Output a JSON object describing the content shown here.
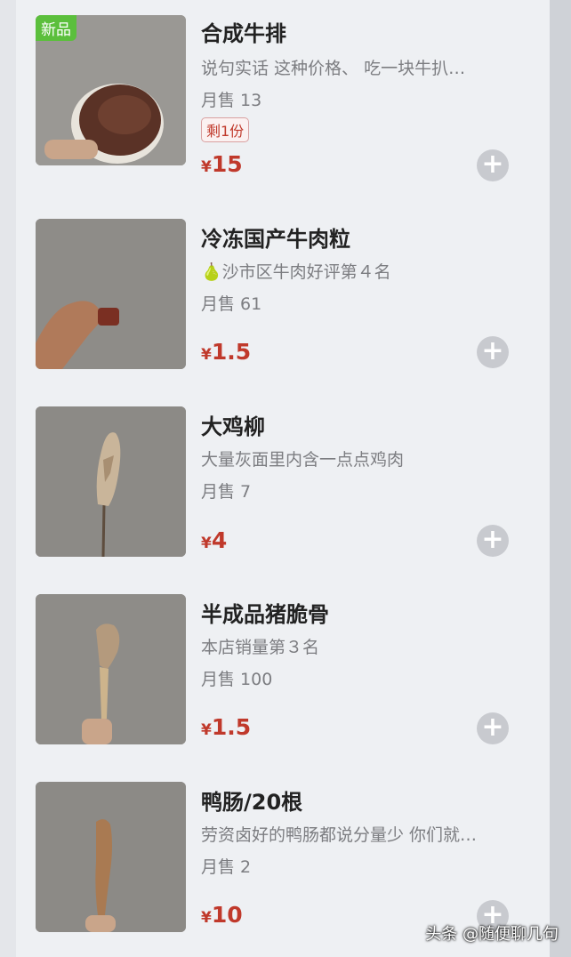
{
  "items": [
    {
      "title": "合成牛排",
      "desc": "说句实话 这种价格、 吃一块牛扒…",
      "sales": "月售 13",
      "stock": "剩1份",
      "badge": "新品",
      "currency": "¥",
      "price": "15"
    },
    {
      "title": "冷冻国产牛肉粒",
      "desc": "🍐沙市区牛肉好评第４名",
      "sales": "月售 61",
      "currency": "¥",
      "price": "1.5"
    },
    {
      "title": "大鸡柳",
      "desc": "大量灰面里内含一点点鸡肉",
      "sales": "月售 7",
      "currency": "¥",
      "price": "4"
    },
    {
      "title": "半成品猪脆骨",
      "desc": "本店销量第３名",
      "sales": "月售 100",
      "currency": "¥",
      "price": "1.5"
    },
    {
      "title": "鸭肠/20根",
      "desc": "劳资卤好的鸭肠都说分量少 你们就…",
      "sales": "月售 2",
      "currency": "¥",
      "price": "10"
    }
  ],
  "add_icon": "plus-circle-icon",
  "watermark": "头条 @随便聊几句",
  "colors": {
    "price": "#c0392b",
    "badge_new": "#5bbf3c",
    "add_button": "#c8cacf"
  }
}
